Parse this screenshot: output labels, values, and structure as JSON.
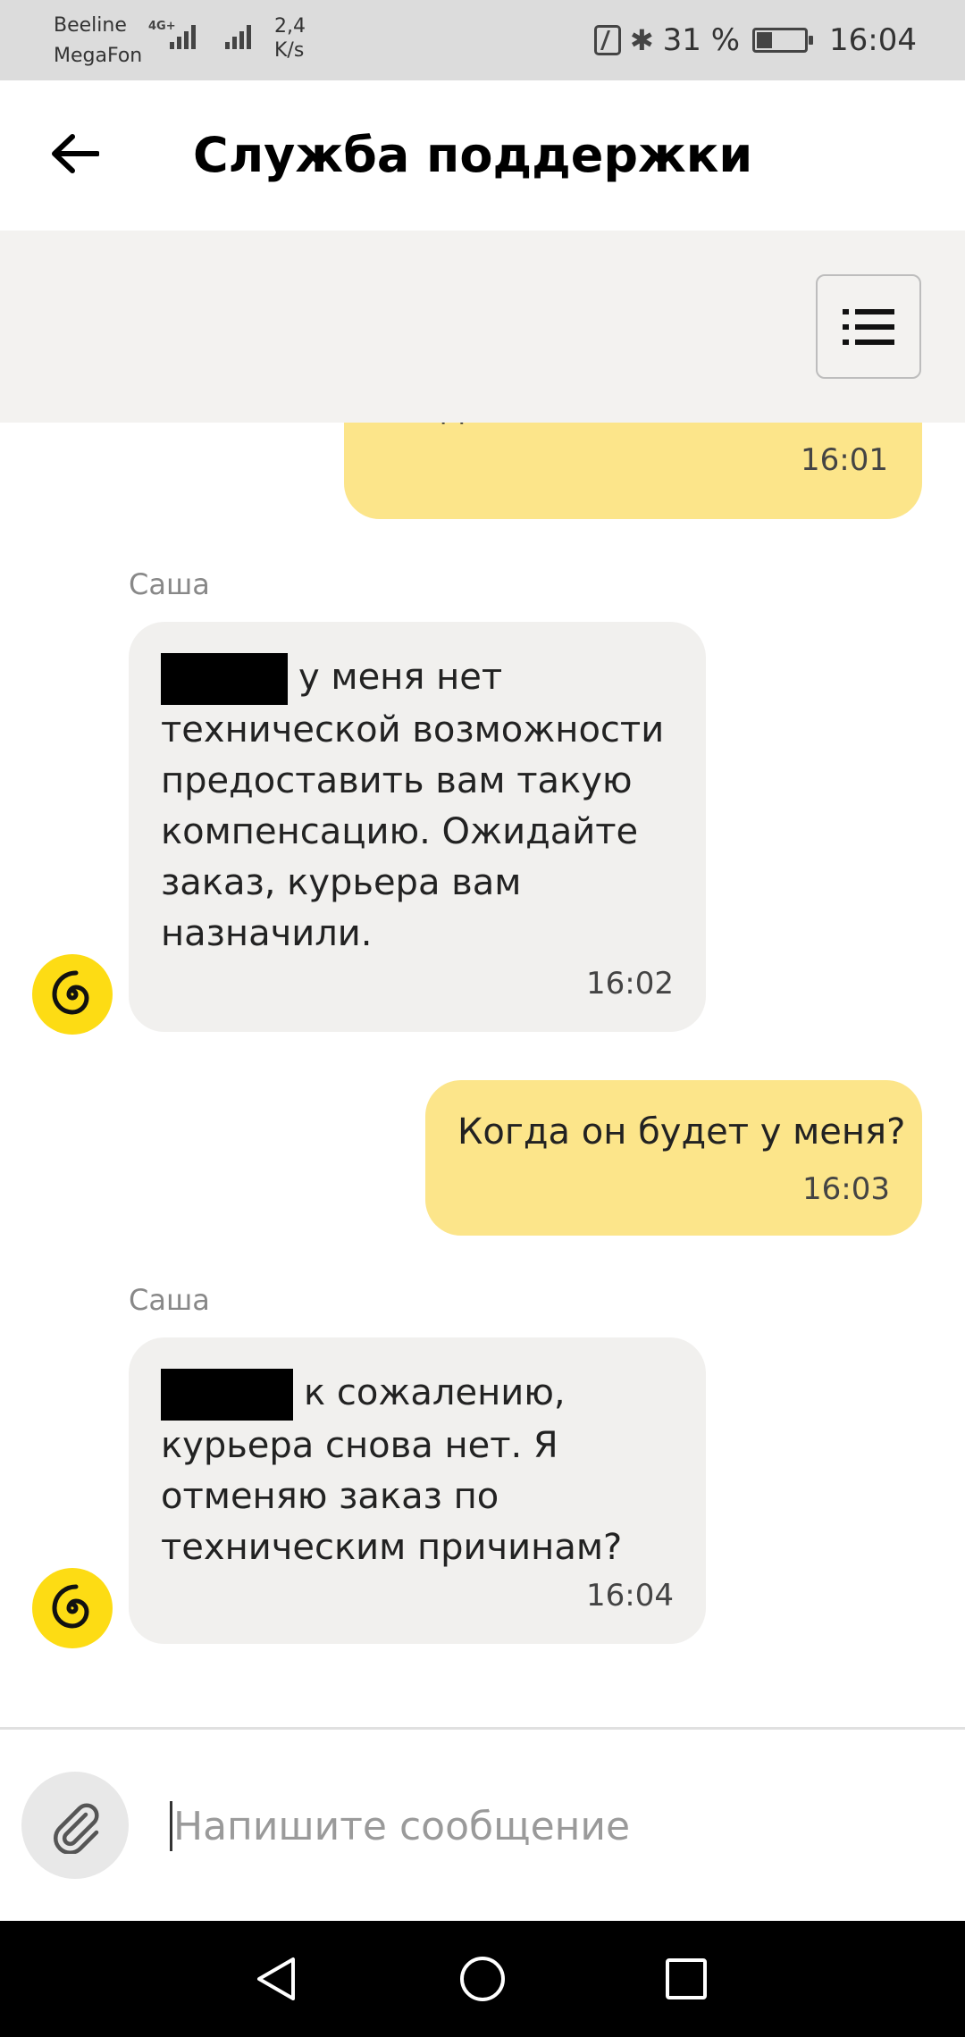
{
  "status_bar": {
    "carrier1": "Beeline",
    "carrier2": "MegaFon",
    "net_label": "4G+",
    "speed_value": "2,4",
    "speed_unit": "K/s",
    "battery_percent": "31 %",
    "battery_level": 0.31,
    "time": "16:04",
    "icons": [
      "signal-icon",
      "nfc-icon",
      "bluetooth-icon",
      "battery-icon"
    ]
  },
  "header": {
    "title": "Служба поддержки",
    "back_icon": "arrow-left-icon"
  },
  "menu_icon": "list-menu-icon",
  "messages": [
    {
      "direction": "out",
      "text": "когда отменяйте?",
      "time": "16:01"
    },
    {
      "direction": "in",
      "sender": "Саша",
      "redacted": true,
      "text_first": "у меня нет",
      "text_rest": "технической возможности предоставить вам такую компенсацию. Ожидайте заказ, курьера вам назначили.",
      "time": "16:02"
    },
    {
      "direction": "out",
      "text": "Когда он будет у меня?",
      "time": "16:03"
    },
    {
      "direction": "in",
      "sender": "Саша",
      "redacted": true,
      "text_first": "к сожалению,",
      "text_rest": "курьера снова нет. Я отменяю заказ по техническим причинам?",
      "time": "16:04"
    }
  ],
  "input": {
    "placeholder": "Напишите сообщение",
    "value": "",
    "attach_icon": "paperclip-icon"
  },
  "nav": [
    "back-nav-icon",
    "home-nav-icon",
    "recents-nav-icon"
  ],
  "colors": {
    "outgoing_bubble": "#fce58a",
    "incoming_bubble": "#f1f0ee",
    "avatar": "#fddc14"
  }
}
